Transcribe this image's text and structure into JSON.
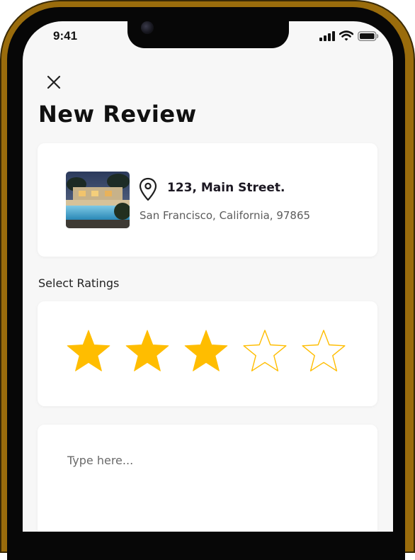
{
  "status_bar": {
    "time": "9:41",
    "icons": [
      "cellular-signal-icon",
      "wifi-icon",
      "battery-icon"
    ]
  },
  "header": {
    "close_icon": "close-icon",
    "title": "New Review"
  },
  "location": {
    "street": "123, Main Street.",
    "city": "San Francisco, California, 97865",
    "pin_icon": "location-pin-icon",
    "thumbnail": "pool-house-photo"
  },
  "rating": {
    "label": "Select  Ratings",
    "value": 3,
    "max": 5,
    "star_color": "#FFBD00"
  },
  "review": {
    "placeholder": "Type here..."
  },
  "colors": {
    "frame": "#9A6C0C",
    "screen_bg": "#F7F7F7",
    "card_bg": "#FFFFFF",
    "text_primary": "#111111"
  }
}
